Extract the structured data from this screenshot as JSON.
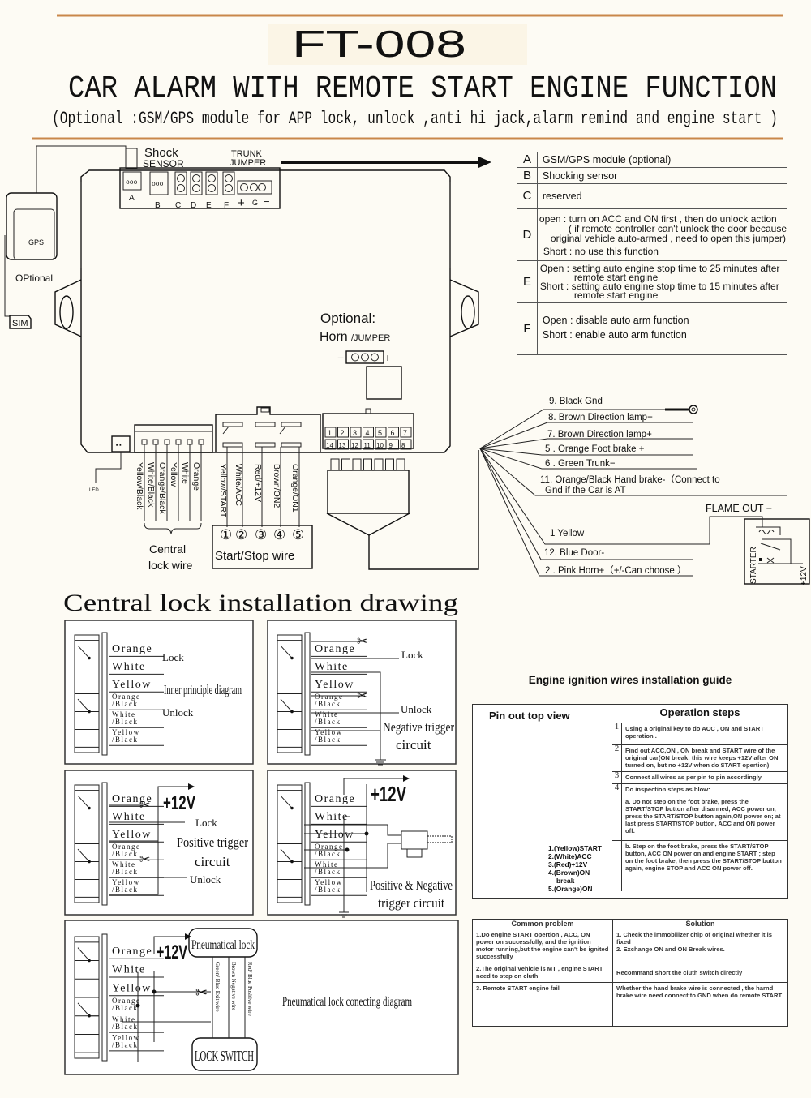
{
  "header": {
    "model": "FT-008",
    "title": "CAR ALARM WITH REMOTE  START ENGINE FUNCTION",
    "subtitle": "(Optional :GSM/GPS module for APP lock, unlock ,anti hi jack,alarm remind and engine start )"
  },
  "colors": {
    "rule": "#c9874a",
    "background": "#fdfbf4",
    "line": "#111111"
  },
  "module": {
    "shock": "Shock",
    "sensor": "SENSOR",
    "trunk": "TRUNK",
    "jumper": "JUMPER",
    "jumpers": [
      "A",
      "B",
      "C",
      "D",
      "E",
      "F"
    ],
    "g_plus": "+",
    "g_label": "G",
    "g_minus": "−",
    "gps": "GPS",
    "gps_optional": "OPtional",
    "sim": "SIM",
    "horn_optional": "Optional:",
    "horn": "Horn",
    "horn_jumper": "/JUMPER",
    "horn_minus": "−",
    "horn_plus": "+",
    "led": "LED",
    "central_lock_wires": [
      "Yellow/Black",
      "White/Black",
      "Orange/Black",
      "Yellow",
      "White",
      "Orange"
    ],
    "start_stop_wires": [
      "Yellow/START",
      "White/ACC",
      "Red/+12V",
      "Brown/ON2",
      "Orange/ON1"
    ],
    "start_stop_numbers": [
      "①",
      "②",
      "③",
      "④",
      "⑤"
    ],
    "central_lock_label": [
      "Central",
      "lock wire"
    ],
    "start_stop_label": "Start/Stop wire",
    "pins_top": [
      "1",
      "2",
      "3",
      "4",
      "5",
      "6",
      "7"
    ],
    "pins_bottom": [
      "14",
      "13",
      "12",
      "11",
      "10",
      "9",
      "8"
    ]
  },
  "jumper_table": [
    {
      "letter": "A",
      "lines": [
        "GSM/GPS module (optional)"
      ]
    },
    {
      "letter": "B",
      "lines": [
        "Shocking sensor"
      ]
    },
    {
      "letter": "C",
      "lines": [
        "reserved"
      ]
    },
    {
      "letter": "D",
      "lines": [
        "open : turn on ACC and ON first , then do unlock action",
        "( if remote controller can't unlock the door because",
        "original vehicle auto-armed , need to open this jumper)",
        "Short : no use this function"
      ]
    },
    {
      "letter": "E",
      "lines": [
        "Open : setting auto engine stop time to 25 minutes after",
        "remote start engine",
        "Short : setting auto engine stop time to 15 minutes after",
        "remote start engine"
      ]
    },
    {
      "letter": "F",
      "lines": [
        "Open : disable auto arm function",
        "Short : enable auto arm function"
      ]
    }
  ],
  "harness": {
    "wires": [
      "9. Black  Gnd",
      "8. Brown  Direction lamp+",
      "7. Brown  Direction lamp+",
      "5 . Orange  Foot brake  +",
      "6 . Green Trunk−",
      "11. Orange/Black  Hand brake-（Connect to",
      "Gnd if the Car is AT",
      "1  Yellow",
      "12. Blue Door-",
      "2 . Pink Horn+（+/-Can choose ）"
    ],
    "flame_out": "FLAME OUT −",
    "starter": "STARTER",
    "plus12v": "+12V"
  },
  "central_lock": {
    "title": "Central lock installation drawing",
    "wire_labels": [
      [
        "Orange"
      ],
      [
        "White"
      ],
      [
        "Yellow"
      ],
      [
        "Orange",
        "/Black"
      ],
      [
        "White",
        "/Black"
      ],
      [
        "Yellow",
        "/Black"
      ]
    ],
    "panel1": {
      "lock": "Lock",
      "unlock": "Unlock",
      "caption": "Inner principle diagram"
    },
    "panel2": {
      "lock": "Lock",
      "unlock": "Unlock",
      "caption": [
        "Negative trigger",
        "circuit"
      ]
    },
    "panel3": {
      "v12": "+12V",
      "lock": "Lock",
      "unlock": "Unlock",
      "caption": [
        "Positive trigger",
        "circuit"
      ]
    },
    "panel4": {
      "v12": "+12V",
      "caption": [
        "Positive & Negative",
        "trigger circuit"
      ]
    },
    "panel5": {
      "v12": "+12V",
      "pneumatic": "Pneumatical lock",
      "switch": "LOCK SWITCH",
      "wire1": "Green/ Blue  Exit wire",
      "wire2": "Brown  Negative wire",
      "wire3": "Red/ Blue  Positive wire",
      "caption": "Pneumatical lock conecting diagram"
    }
  },
  "engine_guide": {
    "title": "Engine ignition wires installation guide",
    "pinout_title": "Pin out top view",
    "pin_numbers": [
      "1",
      "2",
      "3",
      "4",
      "5"
    ],
    "pins": [
      "1.(Yellow)START",
      "2.(White)ACC",
      "3.(Red)+12V",
      "4.(Brown)ON",
      "break",
      "5.(Orange)ON"
    ],
    "operation_title": "Operation steps",
    "steps": [
      {
        "n": "1",
        "text": "Using a original key to do ACC , ON and START operation ."
      },
      {
        "n": "2",
        "text": "Find out ACC,ON , ON break and START wire of the original car(ON break: this wire keeps +12V after ON turned on, but no +12V when do START opertion)"
      },
      {
        "n": "3",
        "text": "Connect all wires as per pin to pin accordingly"
      },
      {
        "n": "4",
        "text": "Do inspection steps as blow:"
      },
      {
        "n": "",
        "text": "a. Do not step on the foot brake, press the START/STOP button after disarmed, ACC power on, press the START/STOP button again,ON power on; at last press START/STOP button, ACC and ON power off."
      },
      {
        "n": "",
        "text": "b. Step on the foot brake, press the START/STOP button, ACC ON power on and engine START ; step on the foot brake, then press the START/STOP button again, engine STOP and ACC ON power off."
      }
    ],
    "problems_header": "Common problem",
    "solution_header": "Solution",
    "problems": [
      {
        "problem": "1.Do engine START opertion ,  ACC, ON power on successfully, and the ignition motor running,but the engine can't be ignited successfully",
        "solution": [
          "1. Check the immobilizer chip of original whether it is fixed",
          "2. Exchange ON and ON Break wires."
        ]
      },
      {
        "problem": "2.The original vehicle is MT , engine START need to step on cluth",
        "solution": [
          "Recommand short the cluth switch directly"
        ]
      },
      {
        "problem": "3.  Remote START engine fail",
        "solution": [
          "Whether the hand brake wire is connected , the harnd brake wire need connect to GND when do remote START"
        ]
      }
    ]
  }
}
